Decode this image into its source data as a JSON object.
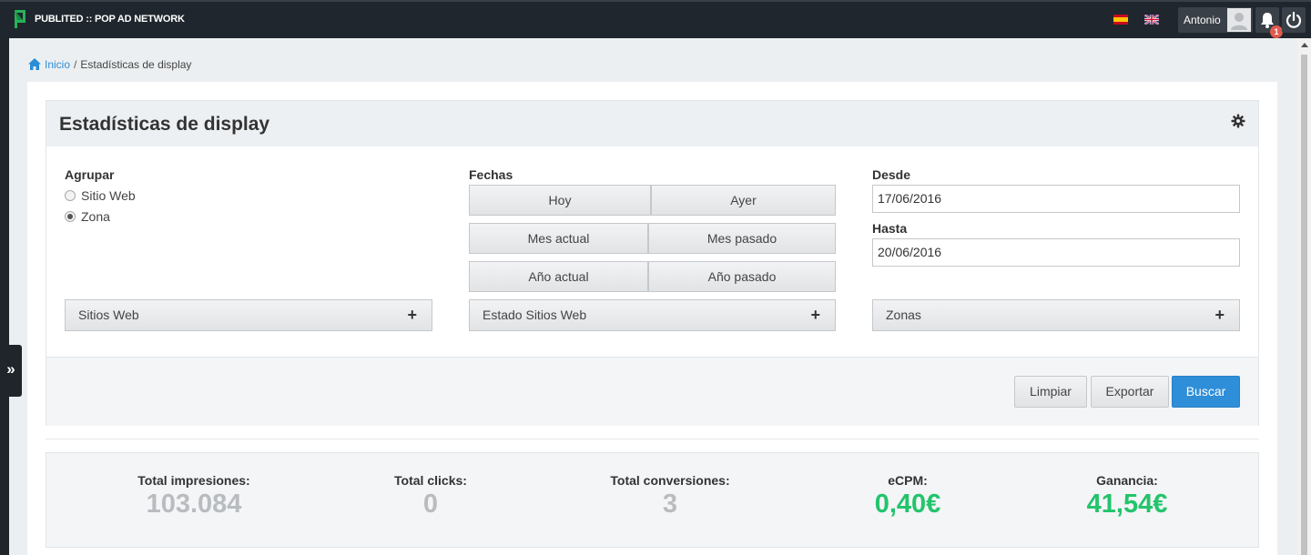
{
  "app": {
    "title": "PUBLITED :: POP AD NETWORK"
  },
  "user": {
    "name": "Antonio"
  },
  "notifications": {
    "count": "1"
  },
  "breadcrumb": {
    "home": "Inicio",
    "separator": "/",
    "current": "Estadísticas de display"
  },
  "page": {
    "title": "Estadísticas de display"
  },
  "filters": {
    "group": {
      "label": "Agrupar",
      "options": [
        {
          "label": "Sitio Web",
          "checked": false
        },
        {
          "label": "Zona",
          "checked": true
        }
      ]
    },
    "dates": {
      "label": "Fechas",
      "buttons": [
        "Hoy",
        "Ayer",
        "Mes actual",
        "Mes pasado",
        "Año actual",
        "Año pasado"
      ]
    },
    "from": {
      "label": "Desde",
      "value": "17/06/2016"
    },
    "to": {
      "label": "Hasta",
      "value": "20/06/2016"
    },
    "collapsibles": [
      "Sitios Web",
      "Estado Sitios Web",
      "Zonas"
    ],
    "plus": "+"
  },
  "actions": {
    "clear": "Limpiar",
    "export": "Exportar",
    "search": "Buscar"
  },
  "stats": [
    {
      "label": "Total impresiones:",
      "value": "103.084",
      "tone": "grey"
    },
    {
      "label": "Total clicks:",
      "value": "0",
      "tone": "grey"
    },
    {
      "label": "Total conversiones:",
      "value": "3",
      "tone": "grey"
    },
    {
      "label": "eCPM:",
      "value": "0,40€",
      "tone": "green"
    },
    {
      "label": "Ganancia:",
      "value": "41,54€",
      "tone": "green"
    }
  ],
  "sidebar_toggle": {
    "label": "»"
  },
  "icons": {
    "logo": "publited-logo",
    "flags": [
      "spain-flag-icon",
      "uk-flag-icon"
    ],
    "user": "user-avatar-icon",
    "bell": "bell-icon",
    "power": "power-icon",
    "home": "home-icon",
    "gear": "gear-icon"
  },
  "colors": {
    "navbar": "#1f262d",
    "primary": "#2f8ed8",
    "positive": "#23c46b",
    "muted": "#b9bcbf",
    "link": "#2a8dd6"
  }
}
